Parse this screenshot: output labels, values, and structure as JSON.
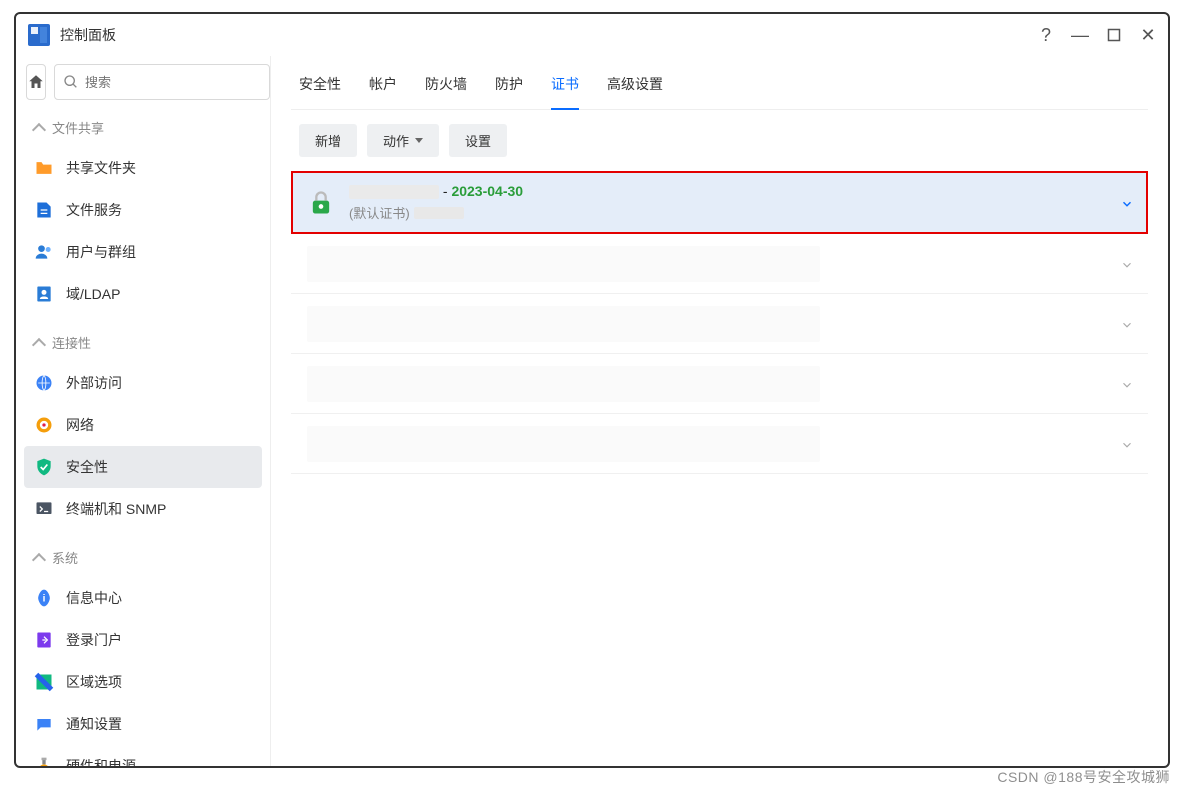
{
  "window": {
    "title": "控制面板"
  },
  "search": {
    "placeholder": "搜索"
  },
  "sidebar": {
    "sections": [
      {
        "title": "文件共享",
        "items": [
          {
            "label": "共享文件夹",
            "icon": "folder-icon",
            "color": "#ff9b2a"
          },
          {
            "label": "文件服务",
            "icon": "file-service-icon",
            "color": "#1e6fd9"
          },
          {
            "label": "用户与群组",
            "icon": "users-icon",
            "color": "#2a7cd6"
          },
          {
            "label": "域/LDAP",
            "icon": "ldap-icon",
            "color": "#2a7cd6"
          }
        ]
      },
      {
        "title": "连接性",
        "items": [
          {
            "label": "外部访问",
            "icon": "external-access-icon",
            "color": "#3b82f6"
          },
          {
            "label": "网络",
            "icon": "network-icon",
            "color": "#f59e0b"
          },
          {
            "label": "安全性",
            "icon": "security-icon",
            "color": "#10b981",
            "active": true
          },
          {
            "label": "终端机和 SNMP",
            "icon": "terminal-icon",
            "color": "#4b5563"
          }
        ]
      },
      {
        "title": "系统",
        "items": [
          {
            "label": "信息中心",
            "icon": "info-icon",
            "color": "#3b82f6"
          },
          {
            "label": "登录门户",
            "icon": "portal-icon",
            "color": "#7c3aed"
          },
          {
            "label": "区域选项",
            "icon": "region-icon",
            "color": "#10b981"
          },
          {
            "label": "通知设置",
            "icon": "notification-icon",
            "color": "#3b82f6"
          },
          {
            "label": "硬件和电源",
            "icon": "hardware-icon",
            "color": "#f59e0b"
          }
        ]
      }
    ]
  },
  "tabs": [
    {
      "label": "安全性"
    },
    {
      "label": "帐户"
    },
    {
      "label": "防火墙"
    },
    {
      "label": "防护"
    },
    {
      "label": "证书",
      "active": true
    },
    {
      "label": "高级设置"
    }
  ],
  "toolbar": {
    "add": "新增",
    "action": "动作",
    "settings": "设置"
  },
  "certs": [
    {
      "date": "2023-04-30",
      "default_label": "(默认证书)",
      "selected": true
    },
    {
      "placeholder": true
    },
    {
      "placeholder": true
    },
    {
      "placeholder": true
    },
    {
      "placeholder": true
    }
  ],
  "watermark": "CSDN @188号安全攻城狮"
}
